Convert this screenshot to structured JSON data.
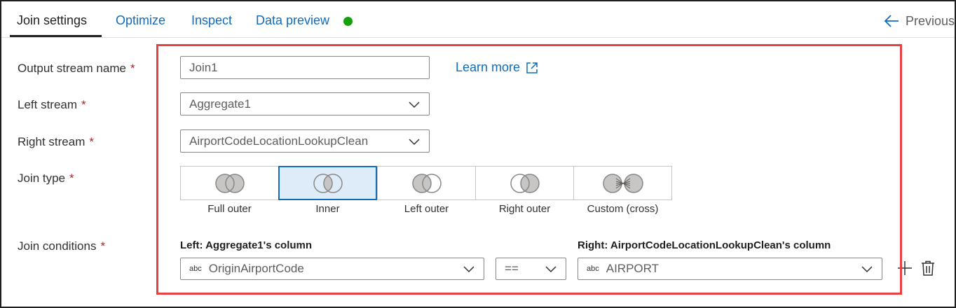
{
  "tabs": [
    {
      "label": "Join settings",
      "active": true
    },
    {
      "label": "Optimize",
      "active": false
    },
    {
      "label": "Inspect",
      "active": false
    },
    {
      "label": "Data preview",
      "active": false
    }
  ],
  "previous_label": "Previous",
  "colors": {
    "accent": "#0f6cbd",
    "status_dot": "#13a10e",
    "highlight": "#e8413f",
    "required": "#a4262c"
  },
  "form": {
    "output_stream": {
      "label": "Output stream name",
      "value": "Join1"
    },
    "left_stream": {
      "label": "Left stream",
      "value": "Aggregate1"
    },
    "right_stream": {
      "label": "Right stream",
      "value": "AirportCodeLocationLookupClean"
    },
    "join_type": {
      "label": "Join type",
      "selected": "Inner"
    },
    "join_conditions": {
      "label": "Join conditions"
    },
    "required_mark": "*",
    "learn_more": "Learn more"
  },
  "join_types": [
    "Full outer",
    "Inner",
    "Left outer",
    "Right outer",
    "Custom (cross)"
  ],
  "conditions": {
    "left_header": "Left: Aggregate1's column",
    "right_header": "Right: AirportCodeLocationLookupClean's column",
    "type_badge": "abc",
    "left_value": "OriginAirportCode",
    "operator": "==",
    "right_value": "AIRPORT"
  }
}
